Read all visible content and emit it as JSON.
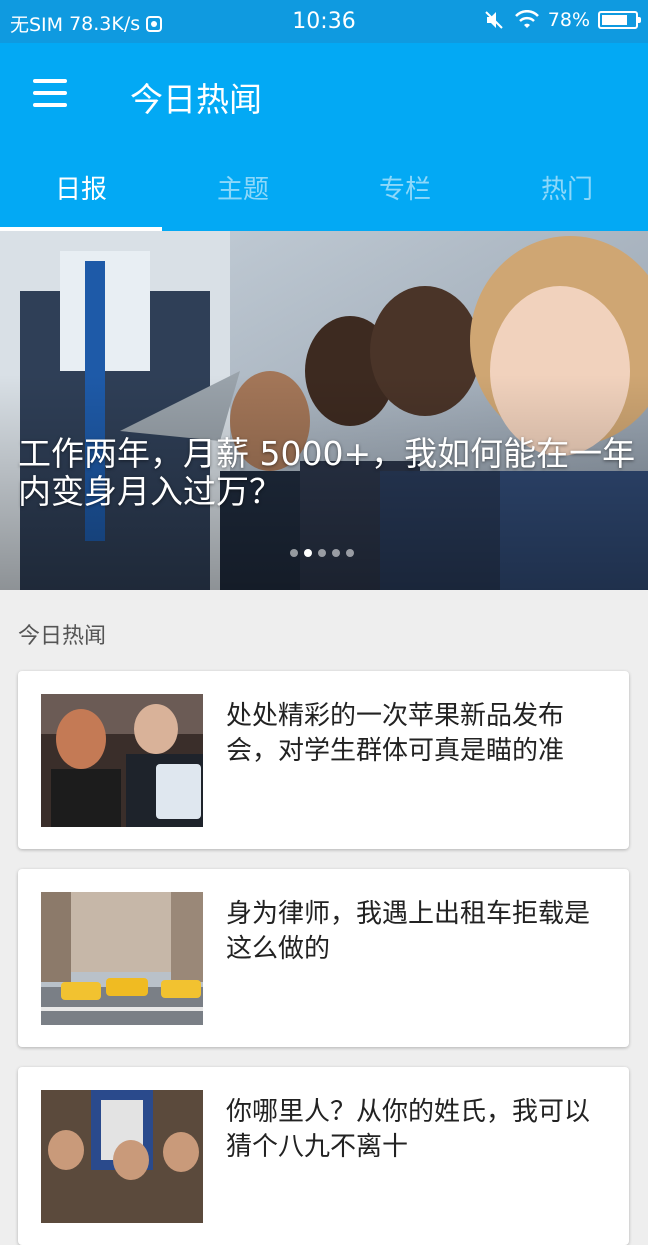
{
  "status_bar": {
    "carrier": "无SIM",
    "speed": "78.3K/s",
    "time": "10:36",
    "battery": "78%",
    "battery_level": 0.78
  },
  "app_bar": {
    "title": "今日热闻",
    "menu_icon": "menu-icon"
  },
  "tabs": [
    {
      "label": "日报",
      "active": true
    },
    {
      "label": "主题",
      "active": false
    },
    {
      "label": "专栏",
      "active": false
    },
    {
      "label": "热门",
      "active": false
    }
  ],
  "banner": {
    "title": "工作两年，月薪 5000+，我如何能在一年内变身月入过万？",
    "page_count": 5,
    "active_index": 1
  },
  "section": {
    "title": "今日热闻"
  },
  "stories": [
    {
      "title": "处处精彩的一次苹果新品发布会，对学生群体可真是瞄的准"
    },
    {
      "title": "身为律师，我遇上出租车拒载是这么做的"
    },
    {
      "title": "你哪里人？从你的姓氏，我可以猜个八九不离十"
    }
  ],
  "colors": {
    "status_bar": "#0f9ae0",
    "primary": "#03a9f4",
    "background": "#eeeeee"
  }
}
